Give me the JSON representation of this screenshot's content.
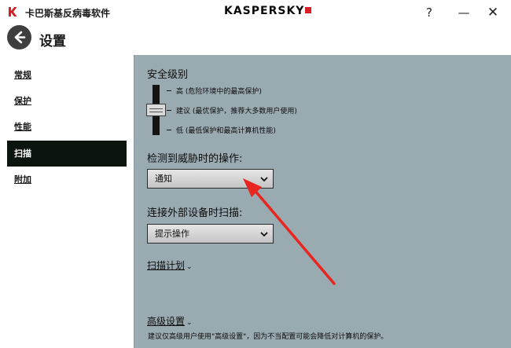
{
  "window": {
    "app_title": "卡巴斯基反病毒软件",
    "brand": "KASPERSKY",
    "help_label": "?",
    "minimize_label": "—",
    "close_label": "✕"
  },
  "header": {
    "page_title": "设置"
  },
  "sidebar": {
    "items": [
      {
        "label": "常规"
      },
      {
        "label": "保护"
      },
      {
        "label": "性能"
      },
      {
        "label": "扫描"
      },
      {
        "label": "附加"
      }
    ],
    "active_index": 3
  },
  "main": {
    "security_level": {
      "title": "安全级别",
      "levels": [
        {
          "label": "高 (危险环境中的最高保护)"
        },
        {
          "label": "建议 (最优保护，推荐大多数用户使用)"
        },
        {
          "label": "低 (最低保护和最高计算机性能)"
        }
      ],
      "selected": "建议 (最优保护，推荐大多数用户使用)"
    },
    "threat_action": {
      "label": "检测到威胁时的操作:",
      "value": "通知"
    },
    "external_device": {
      "label": "连接外部设备时扫描:",
      "value": "提示操作"
    },
    "scan_schedule_link": "扫描计划",
    "advanced_settings_link": "高级设置",
    "advanced_hint": "建议仅高级用户使用\"高级设置\"，因为不当配置可能会降低对计算机的保护。"
  },
  "colors": {
    "content_bg": "#9aaab1",
    "active_nav_bg": "#0c140e",
    "brand_red": "#d71f26",
    "annotation_arrow": "#e8251f"
  }
}
